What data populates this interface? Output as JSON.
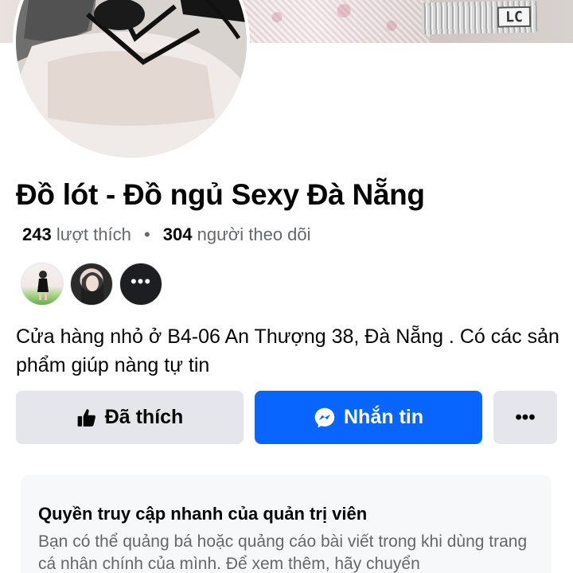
{
  "cover": {
    "strap_logo": "LC"
  },
  "page": {
    "title": "Đồ lót - Đồ ngủ Sexy Đà Nẵng",
    "likes_count": "243",
    "likes_label": "lượt thích",
    "separator": "•",
    "followers_count": "304",
    "followers_label": "người theo dõi",
    "about": "Cửa hàng nhỏ ở B4-06 An Thượng 38,  Đà Nẵng . Có các sản phẩm giúp nàng tự tin"
  },
  "friends": {
    "more_glyph": "•••"
  },
  "actions": {
    "like_label": "Đã thích",
    "like_icon": "thumbs-up-icon",
    "message_label": "Nhắn tin",
    "message_icon": "messenger-icon",
    "more_glyph": "•••"
  },
  "admin_card": {
    "title": "Quyền truy cập nhanh của quản trị viên",
    "body": "Bạn có thể quảng bá hoặc quảng cáo bài viết trong khi dùng trang cá nhân chính của mình. Để xem thêm, hãy chuyển"
  },
  "colors": {
    "primary": "#0866ff",
    "button_gray": "#e4e6eb",
    "secondary_text": "#65676b"
  }
}
